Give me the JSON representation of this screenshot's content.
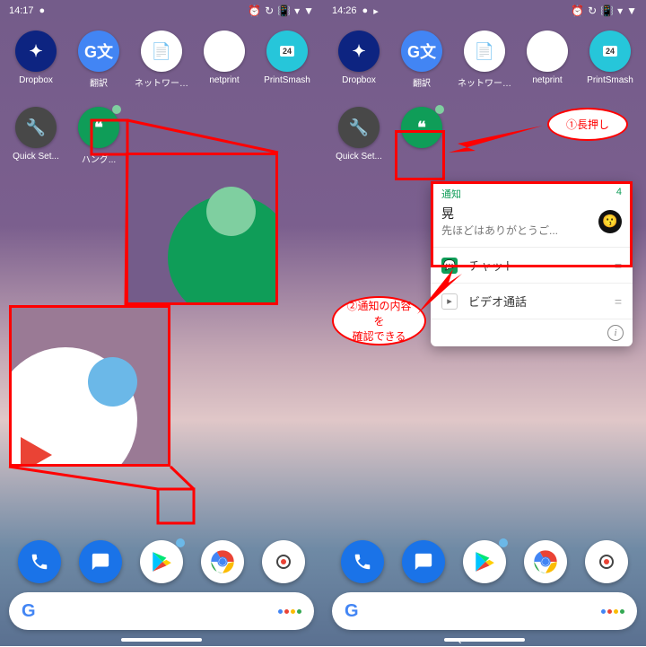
{
  "left": {
    "time": "14:17",
    "status_icons": [
      "⏰",
      "↻",
      "📳",
      "▾",
      "▼"
    ],
    "apps_row1": [
      {
        "label": "Dropbox",
        "icon": "dropbox"
      },
      {
        "label": "翻訳",
        "icon": "translate"
      },
      {
        "label": "ネットワークフ...",
        "icon": "network"
      },
      {
        "label": "netprint",
        "icon": "netprint"
      },
      {
        "label": "PrintSmash",
        "icon": "printsmash"
      }
    ],
    "apps_row2": [
      {
        "label": "Quick Set...",
        "icon": "quickset"
      },
      {
        "label": "ハング...",
        "icon": "hangouts",
        "badge": "green"
      }
    ]
  },
  "right": {
    "time": "14:26",
    "status_icons": [
      "⏰",
      "↻",
      "📳",
      "▾",
      "▼"
    ],
    "apps_row1": [
      {
        "label": "Dropbox",
        "icon": "dropbox"
      },
      {
        "label": "翻訳",
        "icon": "translate"
      },
      {
        "label": "ネットワークフ...",
        "icon": "network"
      },
      {
        "label": "netprint",
        "icon": "netprint"
      },
      {
        "label": "PrintSmash",
        "icon": "printsmash"
      }
    ],
    "apps_row2": [
      {
        "label": "Quick Set...",
        "icon": "quickset"
      },
      {
        "label": "",
        "icon": "hangouts",
        "badge": "green",
        "highlighted": true
      }
    ],
    "popup": {
      "header_title": "通知",
      "header_count": "4",
      "notif_name": "晃",
      "notif_msg": "先ほどはありがとうご...",
      "item1_label": "チャット",
      "item2_label": "ビデオ通話"
    },
    "callout1": "①長押し",
    "callout2_line1": "②通知の内容を",
    "callout2_line2": "確認できる"
  },
  "dock_icons": [
    "phone",
    "message",
    "play",
    "chrome",
    "camera"
  ]
}
